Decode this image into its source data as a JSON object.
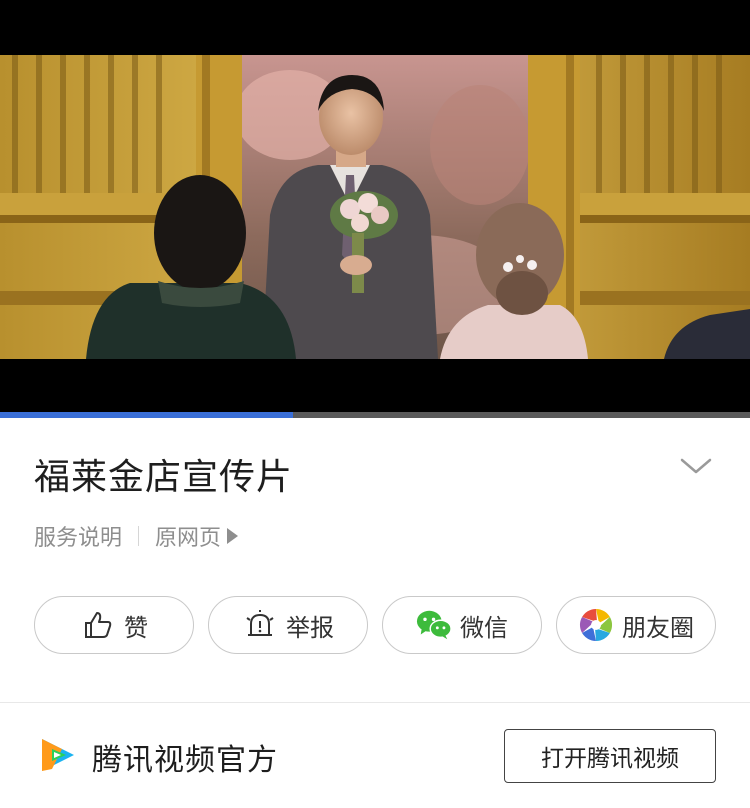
{
  "video": {
    "progress_fraction": 0.39
  },
  "header": {
    "title": "福莱金店宣传片"
  },
  "meta": {
    "service_label": "服务说明",
    "source_label": "原网页"
  },
  "actions": [
    {
      "label": "赞",
      "icon": "thumbs-up-icon"
    },
    {
      "label": "举报",
      "icon": "report-icon"
    },
    {
      "label": "微信",
      "icon": "wechat-icon"
    },
    {
      "label": "朋友圈",
      "icon": "moments-icon"
    }
  ],
  "footer": {
    "brand_name": "腾讯视频官方",
    "open_button_label": "打开腾讯视频"
  },
  "colors": {
    "progress": "#3a6fd8",
    "wechat_green": "#3dbb3c"
  }
}
